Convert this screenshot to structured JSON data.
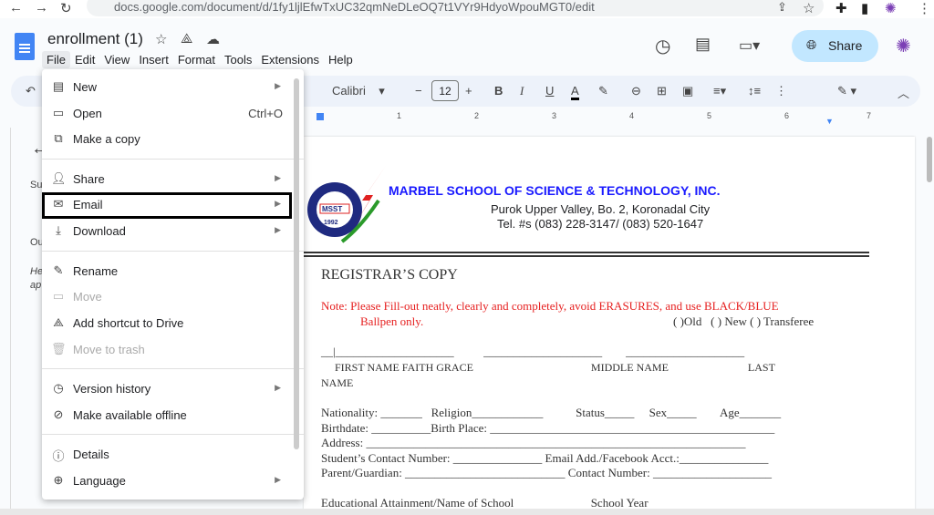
{
  "browser": {
    "url": "docs.google.com/document/d/1fy1ljlEfwTxUC32qmNeDLeOQ7t1VYr9HdyoWpouMGT0/edit"
  },
  "doc": {
    "title": "enrollment (1)",
    "share_label": "Share"
  },
  "menubar": [
    "File",
    "Edit",
    "View",
    "Insert",
    "Format",
    "Tools",
    "Extensions",
    "Help"
  ],
  "toolbar": {
    "font": "Calibri",
    "font_size": "12"
  },
  "ruler": [
    "1",
    "2",
    "3",
    "4",
    "5",
    "6",
    "7"
  ],
  "outline": {
    "summary": "Su",
    "outline": "Ou",
    "hint": "He",
    "hint2": "ap"
  },
  "file_menu": [
    {
      "label": "New",
      "icon": "document-icon",
      "submenu": true
    },
    {
      "label": "Open",
      "icon": "folder-icon",
      "shortcut": "Ctrl+O"
    },
    {
      "label": "Make a copy",
      "icon": "copy-icon"
    },
    {
      "label": "Share",
      "icon": "person-add-icon",
      "submenu": true
    },
    {
      "label": "Email",
      "icon": "mail-icon",
      "submenu": true
    },
    {
      "label": "Download",
      "icon": "download-icon",
      "submenu": true
    },
    {
      "label": "Rename",
      "icon": "pencil-icon"
    },
    {
      "label": "Move",
      "icon": "move-folder-icon",
      "disabled": true
    },
    {
      "label": "Add shortcut to Drive",
      "icon": "drive-shortcut-icon"
    },
    {
      "label": "Move to trash",
      "icon": "trash-icon",
      "disabled": true
    },
    {
      "label": "Version history",
      "icon": "history-icon",
      "submenu": true
    },
    {
      "label": "Make available offline",
      "icon": "offline-icon"
    },
    {
      "label": "Details",
      "icon": "info-icon"
    },
    {
      "label": "Language",
      "icon": "globe-icon",
      "submenu": true
    }
  ],
  "page": {
    "logo_text": [
      "MSST",
      "1992",
      "MOVERSTATE"
    ],
    "school": "MARBEL SCHOOL OF SCIENCE & TECHNOLOGY, INC.",
    "address": "Purok Upper Valley, Bo. 2, Koronadal City",
    "tel": "Tel. #s (083) 228-3147/ (083) 520-1647",
    "heading": "REGISTRAR’S COPY",
    "note1": "Note: Please Fill-out neatly, clearly and completely, avoid ERASURES, and use BLACK/BLUE",
    "note2": "Ballpen only.",
    "status_opts": "( )Old   ( ) New ( ) Transferee",
    "name_lines": "__|____________________          ____________________        ____________________",
    "name_labels": "     FIRST NAME FAITH GRACE                                           MIDDLE NAME                             LAST",
    "name_cont": "NAME",
    "lines": [
      "Nationality: _______   Religion____________           Status_____     Sex_____        Age_______",
      "Birthdate: __________Birth Place: ________________________________________________",
      "Address: ________________________________________________________________",
      "Student’s Contact Number: _______________ Email Add./Facebook Acct.:_______________",
      "Parent/Guardian: ___________________________ Contact Number: ____________________"
    ],
    "edu": "Educational Attainment/Name of School                          School Year"
  }
}
